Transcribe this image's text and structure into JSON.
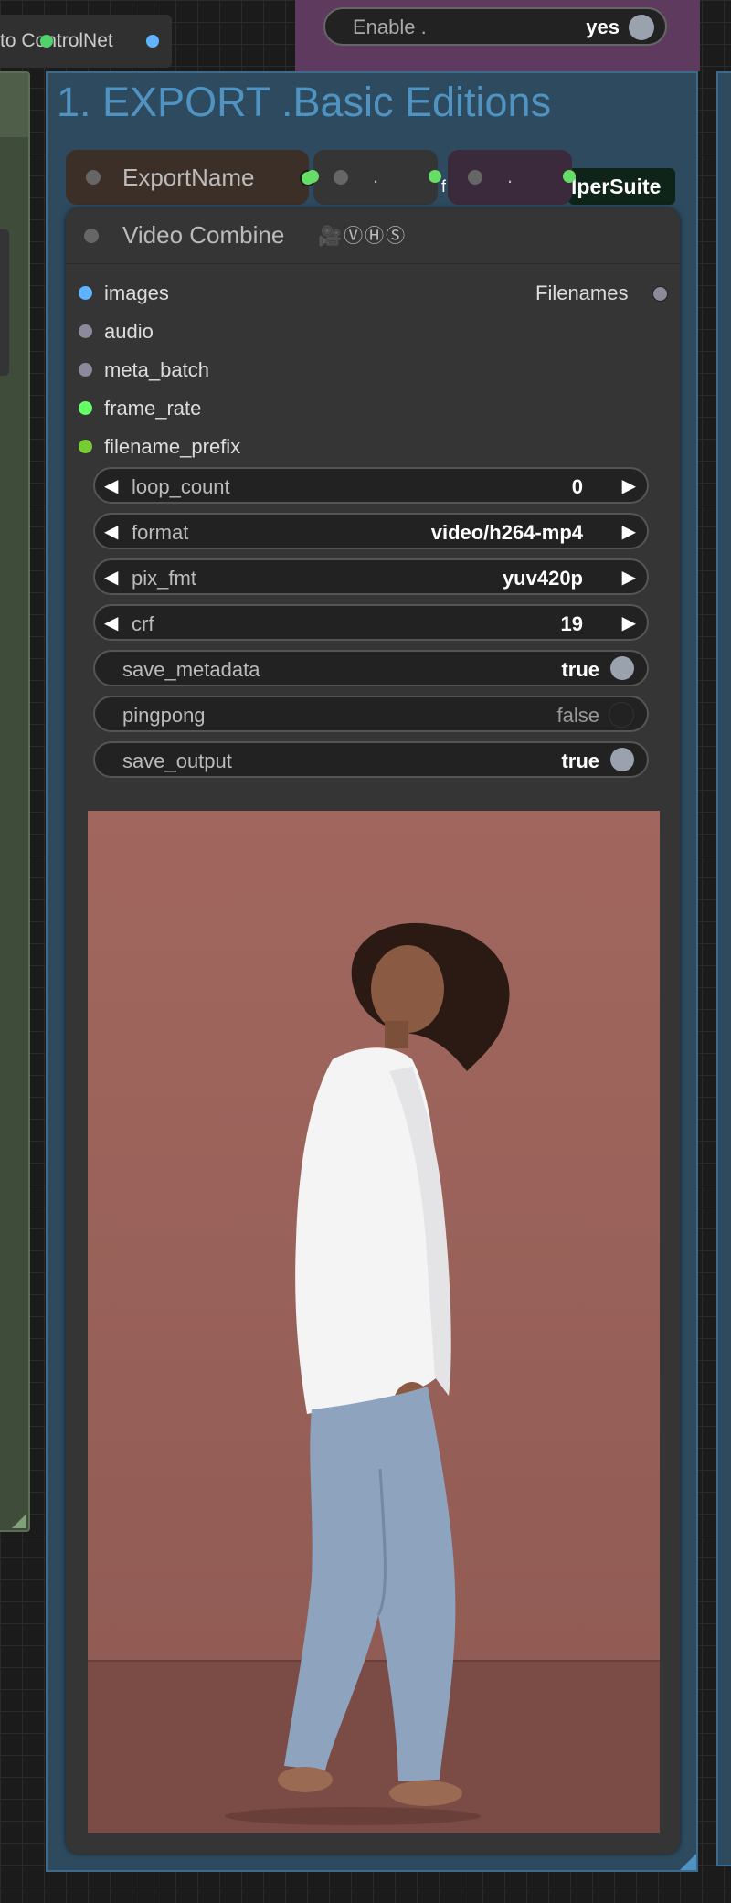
{
  "controlnet_node": {
    "label": "to ControlNet"
  },
  "enable_group": {
    "toggle_name": "Enable .",
    "toggle_value": "yes"
  },
  "export_group": {
    "title": "1. EXPORT .Basic Editions"
  },
  "mini_nodes": {
    "export_name": "ExportName",
    "dot_node_1": ".",
    "dot_node_2": ".",
    "helper_tag": "lperSuite",
    "helper_f": "f"
  },
  "video_combine": {
    "title": "Video Combine",
    "icons": "🎥ⓋⒽⓈ",
    "inputs": [
      "images",
      "audio",
      "meta_batch",
      "frame_rate",
      "filename_prefix"
    ],
    "output": "Filenames",
    "widgets": {
      "loop_count": {
        "name": "loop_count",
        "value": "0"
      },
      "format": {
        "name": "format",
        "value": "video/h264-mp4"
      },
      "pix_fmt": {
        "name": "pix_fmt",
        "value": "yuv420p"
      },
      "crf": {
        "name": "crf",
        "value": "19"
      },
      "save_metadata": {
        "name": "save_metadata",
        "value": "true"
      },
      "pingpong": {
        "name": "pingpong",
        "value": "false"
      },
      "save_output": {
        "name": "save_output",
        "value": "true"
      }
    }
  },
  "colors": {
    "images_slot": "#5fb3ff",
    "audio_slot": "#8a8a9a",
    "meta_batch_slot": "#8a8a9a",
    "frame_rate_slot": "#66ff66",
    "filename_prefix_slot": "#77cc33",
    "group_title": "#4f93c2"
  }
}
